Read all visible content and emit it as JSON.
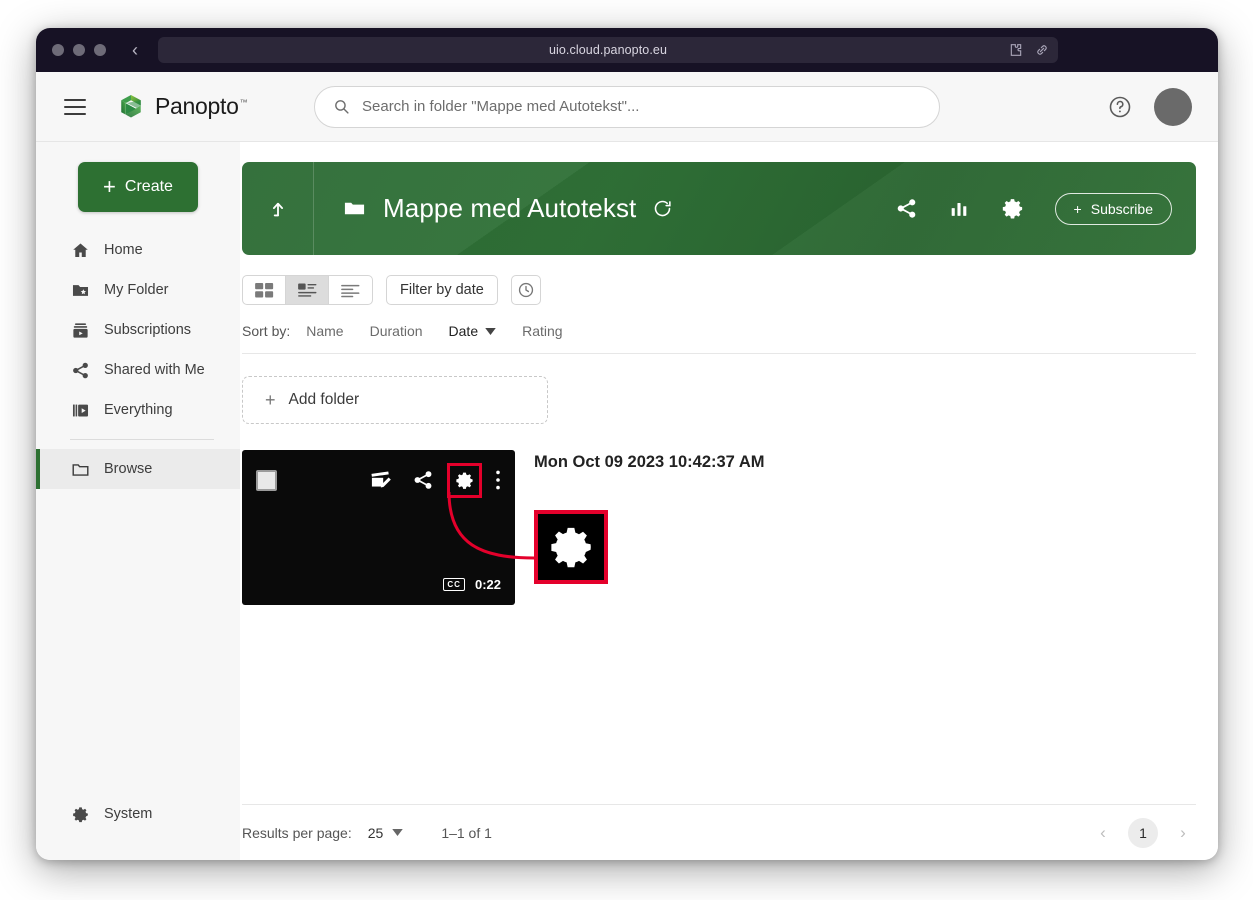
{
  "browser": {
    "url": "uio.cloud.panopto.eu",
    "back_label": "‹",
    "extension_icon": "puzzle-piece-icon",
    "link_icon": "link-icon"
  },
  "appbar": {
    "menu_icon": "hamburger-menu-icon",
    "brand": "Panopto",
    "brand_tm": "™",
    "search": {
      "placeholder": "Search in folder \"Mappe med Autotekst\"...",
      "value": "",
      "icon": "search-icon"
    },
    "help_icon": "help-circle-icon",
    "avatar": "user-avatar"
  },
  "sidebar": {
    "create_label": "Create",
    "items": [
      {
        "label": "Home",
        "icon": "home-icon",
        "active": false
      },
      {
        "label": "My Folder",
        "icon": "folder-star-icon",
        "active": false
      },
      {
        "label": "Subscriptions",
        "icon": "subscriptions-icon",
        "active": false
      },
      {
        "label": "Shared with Me",
        "icon": "share-icon",
        "active": false
      },
      {
        "label": "Everything",
        "icon": "everything-icon",
        "active": false
      },
      {
        "label": "Browse",
        "icon": "folder-icon",
        "active": true
      }
    ],
    "system_label": "System",
    "system_icon": "gear-icon"
  },
  "folder_header": {
    "up_icon": "arrow-up-icon",
    "folder_icon": "folder-icon",
    "name": "Mappe med Autotekst",
    "refresh_icon": "refresh-icon",
    "share_icon": "share-icon",
    "stats_icon": "bar-chart-icon",
    "settings_icon": "gear-icon",
    "subscribe_label": "Subscribe",
    "background_color": "#2d7035"
  },
  "toolbar": {
    "views": [
      {
        "name": "grid-view",
        "active": false
      },
      {
        "name": "thumbnail-list-view",
        "active": true
      },
      {
        "name": "compact-list-view",
        "active": false
      }
    ],
    "filter_label": "Filter by date",
    "recent_icon": "clock-icon"
  },
  "sort": {
    "label": "Sort by:",
    "options": [
      {
        "label": "Name",
        "active": false
      },
      {
        "label": "Duration",
        "active": false
      },
      {
        "label": "Date",
        "active": true
      },
      {
        "label": "Rating",
        "active": false
      }
    ]
  },
  "add_folder": {
    "label": "Add folder",
    "icon": "plus-icon"
  },
  "video": {
    "title": "Mon Oct 09 2023 10:42:37 AM",
    "duration": "0:22",
    "cc_badge": "CC",
    "actions": [
      {
        "name": "edit-video-icon",
        "highlighted": false
      },
      {
        "name": "share-icon",
        "highlighted": false
      },
      {
        "name": "gear-icon",
        "highlighted": true
      },
      {
        "name": "more-options-icon",
        "highlighted": false
      }
    ],
    "checkbox_checked": false
  },
  "callout": {
    "icon": "gear-icon",
    "border_color": "#e4002b"
  },
  "footer": {
    "results_per_page_label": "Results per page:",
    "results_per_page_value": "25",
    "range": "1–1 of 1",
    "prev_label": "‹",
    "next_label": "›",
    "current_page": "1"
  }
}
